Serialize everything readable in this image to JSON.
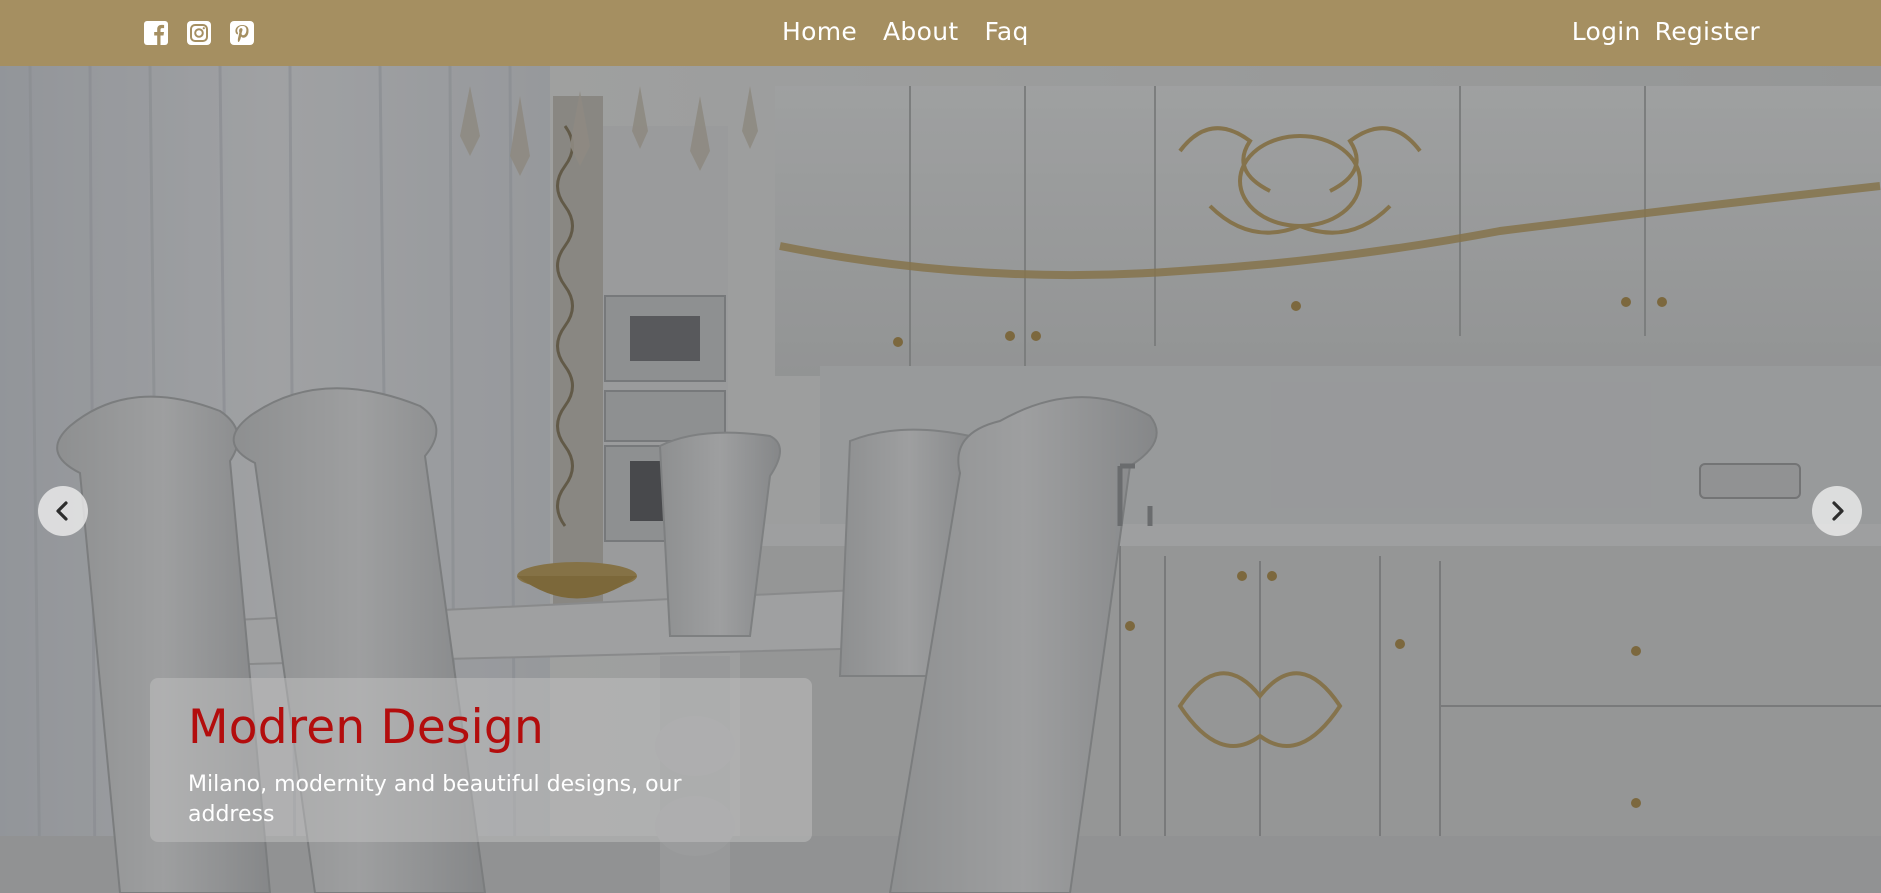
{
  "navbar": {
    "background_color": "#a58f61",
    "social": [
      {
        "icon": "facebook-icon"
      },
      {
        "icon": "instagram-icon"
      },
      {
        "icon": "pinterest-icon"
      }
    ],
    "links": {
      "home": "Home",
      "about": "About",
      "faq": "Faq"
    },
    "auth": {
      "login": "Login",
      "register": "Register"
    }
  },
  "hero": {
    "image": "modern kitchen and dining room with white chairs and gold-ornamented cabinets",
    "prev_icon": "chevron-left-icon",
    "next_icon": "chevron-right-icon",
    "caption": {
      "title": "Modren Design",
      "subtitle": "Milano, modernity and beautiful designs, our address",
      "title_color": "#b30d0d"
    }
  }
}
